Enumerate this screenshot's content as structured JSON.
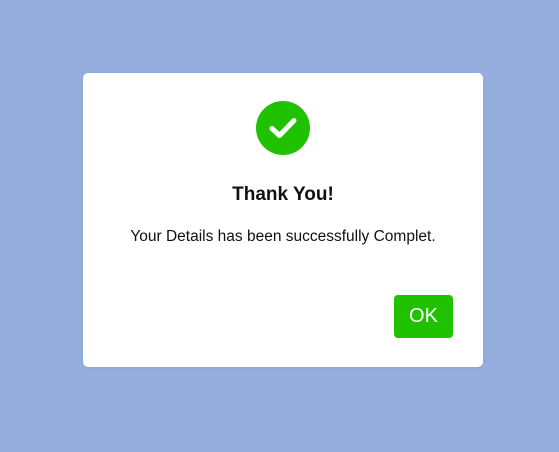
{
  "modal": {
    "icon": "checkmark-circle-icon",
    "title": "Thank You!",
    "message": "Your Details has been successfully Complet.",
    "ok_label": "OK"
  },
  "colors": {
    "background": "#95aedd",
    "accent": "#20c200",
    "modal_background": "#ffffff"
  }
}
